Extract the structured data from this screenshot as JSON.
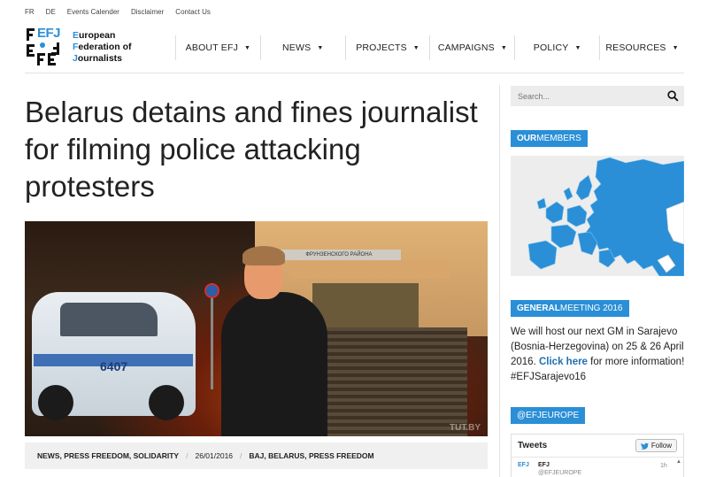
{
  "topbar": {
    "fr": "FR",
    "de": "DE",
    "events": "Events Calender",
    "disclaimer": "Disclaimer",
    "contact": "Contact Us"
  },
  "logo": {
    "mark": "EFJ",
    "line1_cap": "E",
    "line1_rest": "uropean",
    "line2_cap": "F",
    "line2_rest": "ederation of",
    "line3_cap": "J",
    "line3_rest": "ournalists"
  },
  "nav": [
    {
      "label": "ABOUT EFJ"
    },
    {
      "label": "NEWS"
    },
    {
      "label": "PROJECTS"
    },
    {
      "label": "CAMPAIGNS"
    },
    {
      "label": "POLICY"
    },
    {
      "label": "RESOURCES"
    }
  ],
  "article": {
    "title": "Belarus detains and fines journalist for filming police attacking protesters",
    "photo": {
      "van_number": "6407",
      "sign_text": "ФРУНЗЕНСКОГО РАЙОНА",
      "watermark": "TUT.BY"
    },
    "categories": "NEWS, PRESS FREEDOM, SOLIDARITY",
    "date": "26/01/2016",
    "tags": "BAJ, BELARUS, PRESS FREEDOM"
  },
  "sidebar": {
    "search_placeholder": "Search...",
    "members_badge": {
      "strong": "OUR",
      "rest": " MEMBERS"
    },
    "gm_badge": {
      "strong": "GENERAL",
      "rest": " MEETING 2016"
    },
    "gm_text": {
      "before": "We will host our next GM in Sarajevo (Bosnia-Herzegovina) on 25 & 26 April 2016. ",
      "link": "Click here",
      "after": " for more information! #EFJSarajevo16"
    },
    "social_badge": "@EFJEUROPE",
    "tweets": {
      "title": "Tweets",
      "follow": "Follow",
      "name": "EFJ",
      "handle": "@EFJEUROPE",
      "time": "1h"
    }
  },
  "colors": {
    "accent": "#2a8fd6",
    "map_land": "#2a8fd6",
    "map_sea": "#ededed"
  }
}
